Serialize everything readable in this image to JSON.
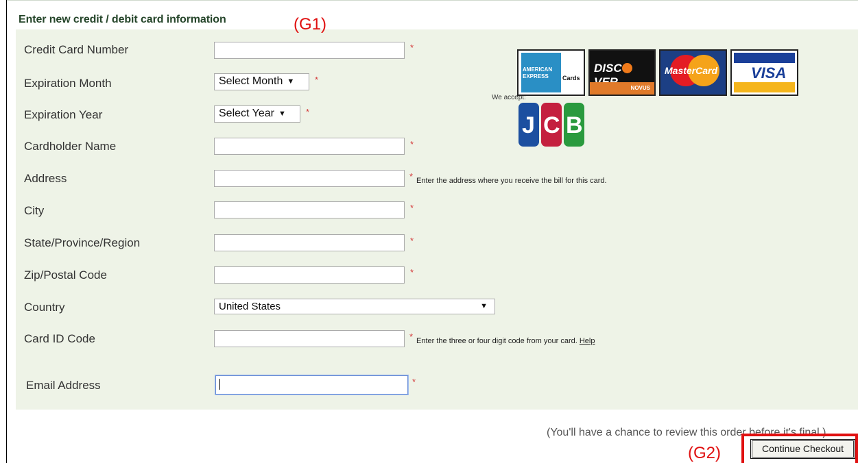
{
  "section_title": "Enter new credit / debit card information",
  "required_mark": "*",
  "fields": {
    "card_number": {
      "label": "Credit Card Number",
      "value": ""
    },
    "exp_month": {
      "label": "Expiration Month",
      "selected": "Select Month"
    },
    "exp_year": {
      "label": "Expiration Year",
      "selected": "Select Year"
    },
    "cardholder": {
      "label": "Cardholder Name",
      "value": ""
    },
    "address": {
      "label": "Address",
      "value": "",
      "hint": "Enter the address where you receive the bill for this card."
    },
    "city": {
      "label": "City",
      "value": ""
    },
    "state": {
      "label": "State/Province/Region",
      "value": ""
    },
    "zip": {
      "label": "Zip/Postal Code",
      "value": ""
    },
    "country": {
      "label": "Country",
      "selected": "United States"
    },
    "card_id": {
      "label": "Card ID Code",
      "value": "",
      "hint": "Enter the three or four digit code from your card.",
      "help_link": "Help"
    },
    "email": {
      "label": "Email Address",
      "value": ""
    }
  },
  "select_arrow": "▼",
  "accepted_cards": {
    "label": "We accept:",
    "amex": {
      "line1": "AMERICAN",
      "line2": "EXPRESS",
      "suffix": "Cards"
    },
    "discover": {
      "text_a": "DISC",
      "text_b": "VER",
      "sub": "NOVUS"
    },
    "mastercard": {
      "text": "MasterCard"
    },
    "visa": {
      "text": "VISA"
    },
    "jcb": {
      "l1": "J",
      "l2": "C",
      "l3": "B"
    }
  },
  "review_note": "(You'll have a chance to review this order before it's final.)",
  "continue_button": "Continue Checkout",
  "annotations": {
    "g1": "(G1)",
    "g2": "(G2)"
  },
  "colors": {
    "panel_bg": "#eef3e7",
    "title": "#25452a",
    "required": "#d43c3c",
    "annotation": "#e01010"
  }
}
